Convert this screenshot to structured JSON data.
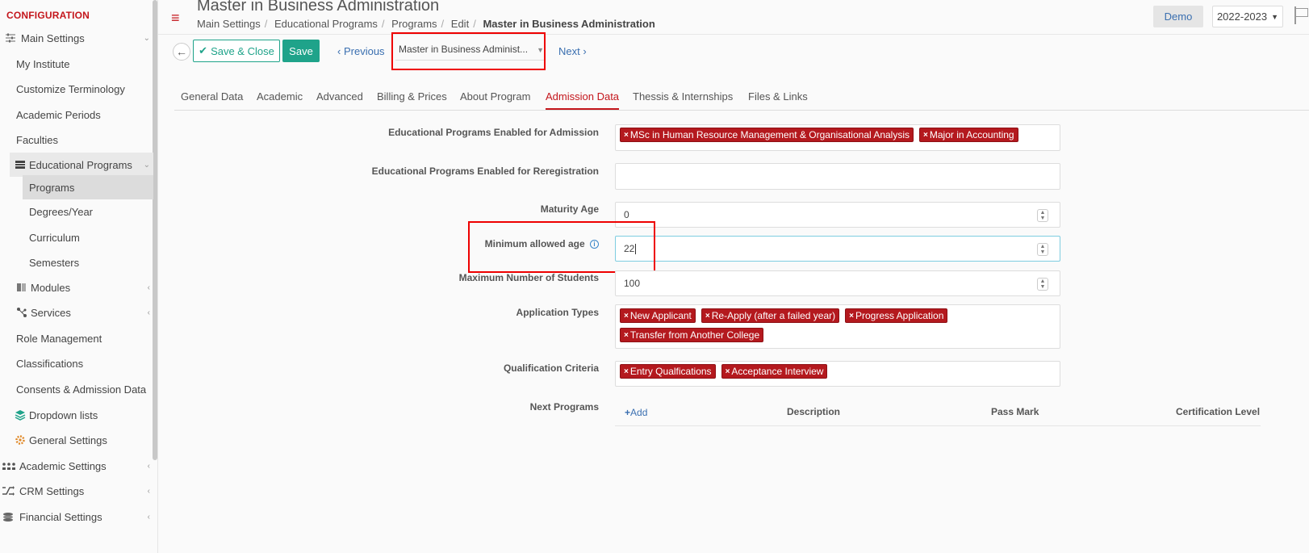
{
  "sidebar": {
    "title": "CONFIGURATION",
    "items": [
      {
        "label": "Main Settings",
        "icon": "sliders-icon"
      },
      {
        "label": "My Institute"
      },
      {
        "label": "Customize Terminology"
      },
      {
        "label": "Academic Periods"
      },
      {
        "label": "Faculties"
      },
      {
        "label": "Educational Programs",
        "icon": "table-icon"
      },
      {
        "label": "Programs"
      },
      {
        "label": "Degrees/Year"
      },
      {
        "label": "Curriculum"
      },
      {
        "label": "Semesters"
      },
      {
        "label": "Modules",
        "icon": "book-icon"
      },
      {
        "label": "Services",
        "icon": "network-icon"
      },
      {
        "label": "Role Management"
      },
      {
        "label": "Classifications"
      },
      {
        "label": "Consents & Admission Data"
      },
      {
        "label": "Dropdown lists",
        "icon": "layers-icon"
      },
      {
        "label": "General Settings",
        "icon": "gear-icon"
      },
      {
        "label": "Academic Settings",
        "icon": "people-icon"
      },
      {
        "label": "CRM Settings",
        "icon": "shuffle-icon"
      },
      {
        "label": "Financial Settings",
        "icon": "coins-icon"
      }
    ]
  },
  "header": {
    "title": "Master in Business Administration",
    "breadcrumbs": [
      "Main Settings",
      "Educational Programs",
      "Programs",
      "Edit"
    ],
    "breadcrumb_current": "Master in Business Administration",
    "demo_label": "Demo",
    "year_label": "2022-2023"
  },
  "toolbar": {
    "save_close_label": "Save & Close",
    "save_label": "Save",
    "previous_label": "Previous",
    "program_select": "Master in Business Administ...",
    "next_label": "Next"
  },
  "tabs": [
    "General Data",
    "Academic",
    "Advanced",
    "Billing & Prices",
    "About Program",
    "Admission Data",
    "Thessis & Internships",
    "Files & Links"
  ],
  "active_tab": "Admission Data",
  "form": {
    "enabled_admission_label": "Educational Programs Enabled for Admission",
    "enabled_admission_tags": [
      "MSc in Human Resource Management & Organisational Analysis",
      "Major in Accounting"
    ],
    "enabled_reregistration_label": "Educational Programs Enabled for Reregistration",
    "maturity_age_label": "Maturity Age",
    "maturity_age_value": "0",
    "min_age_label": "Minimum allowed age",
    "min_age_value": "22",
    "max_students_label": "Maximum Number of Students",
    "max_students_value": "100",
    "application_types_label": "Application Types",
    "application_types_tags": [
      "New Applicant",
      "Re-Apply (after a failed year)",
      "Progress Application",
      "Transfer from Another College"
    ],
    "qualification_label": "Qualification Criteria",
    "qualification_tags": [
      "Entry Qualfications",
      "Acceptance Interview"
    ],
    "next_programs_label": "Next Programs",
    "next_programs_add": "Add",
    "next_programs_cols": [
      "Description",
      "Pass Mark",
      "Certification Level"
    ]
  }
}
